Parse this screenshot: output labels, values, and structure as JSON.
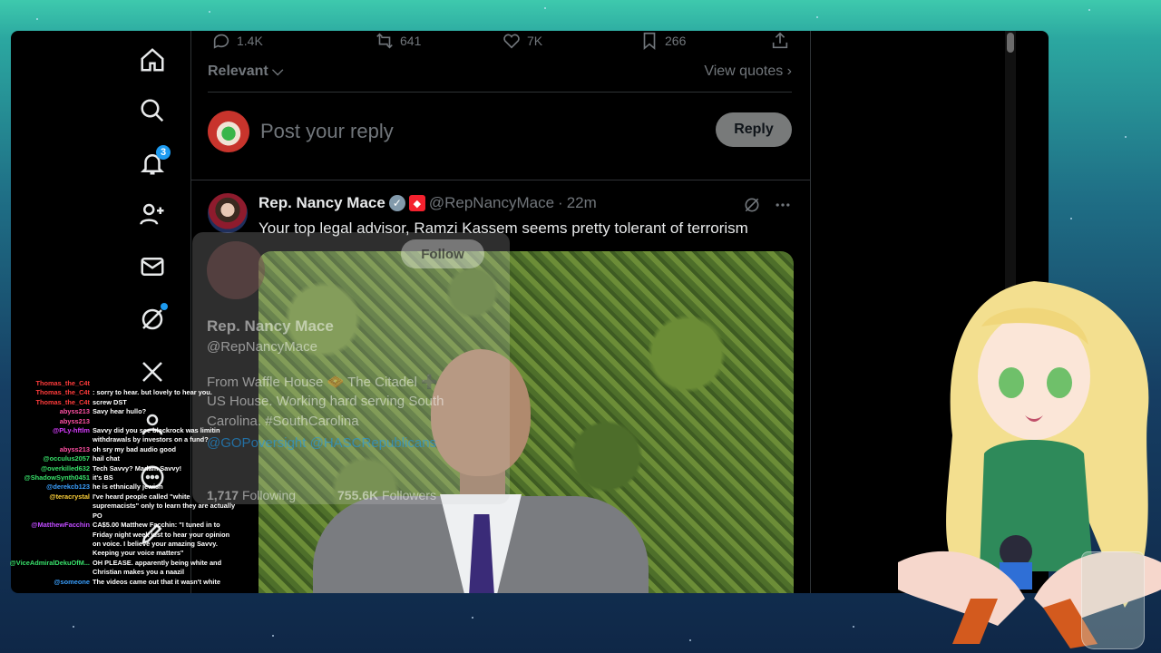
{
  "tweet_actions": {
    "replies": "1.4K",
    "reposts": "641",
    "likes": "7K",
    "bookmarks": "266"
  },
  "sort": {
    "label": "Relevant",
    "view_quotes": "View quotes"
  },
  "reply_box": {
    "placeholder": "Post your reply",
    "button": "Reply"
  },
  "nav": {
    "notifications_count": "3"
  },
  "tweet": {
    "author_name": "Rep. Nancy Mace",
    "handle": "@RepNancyMace",
    "time": "22m",
    "separator": "·",
    "text": "Your top legal advisor, Ramzi Kassem seems pretty tolerant of terrorism"
  },
  "hover_card": {
    "follow": "Follow",
    "name": "Rep. Nancy Mace",
    "handle": "@RepNancyMace",
    "bio_line1": "From Waffle House 🧇 The Citadel ➕",
    "bio_line2": "US House. Working hard serving South",
    "bio_line3": "Carolina. #SouthCarolina",
    "bio_line4": "@GOPoversight @HASCRepublicans",
    "following_count": "1,717",
    "following_label": "Following",
    "followers_count": "755.6K",
    "followers_label": "Followers"
  },
  "chat": [
    {
      "user": "Thomas_the_C4t",
      "color": "#ff3b3b",
      "msg": ""
    },
    {
      "user": "Thomas_the_C4t",
      "color": "#ff3b3b",
      "msg": ": sorry to hear. but lovely to hear you."
    },
    {
      "user": "Thomas_the_C4t",
      "color": "#ff3b3b",
      "msg": "screw DST"
    },
    {
      "user": "abyss213",
      "color": "#ff4fa3",
      "msg": "Savy hear hullo?"
    },
    {
      "user": "abyss213",
      "color": "#ff4fa3",
      "msg": ""
    },
    {
      "user": "@PLy-hftlm",
      "color": "#d73cff",
      "msg": "Savvy did you see blackrock was limitin withdrawals by investors on a fund?"
    },
    {
      "user": "abyss213",
      "color": "#ff4fa3",
      "msg": "oh sry my bad audio good"
    },
    {
      "user": "@occulus2057",
      "color": "#38e06a",
      "msg": "hail chat"
    },
    {
      "user": "@overkilled632",
      "color": "#38e06a",
      "msg": "Tech Savvy? Madam Savvy!"
    },
    {
      "user": "@ShadowSynth0451",
      "color": "#38e06a",
      "msg": "it's BS"
    },
    {
      "user": "@derekcb123",
      "color": "#3aa0ff",
      "msg": "he is ethnically jewish"
    },
    {
      "user": "@teracrystal",
      "color": "#ffd23a",
      "msg": "I've heard people called \"white supremacists\" only to learn they are actually PO"
    },
    {
      "user": "@MatthewFacchin",
      "color": "#c04bff",
      "msg": "CA$5.00 Matthew Facchin: \"I tuned in to Friday night week just to hear your opinion on voice. I believe your amazing Savvy. Keeping your voice matters\""
    },
    {
      "user": "@ViceAdmiralDekuOfM...",
      "color": "#38e06a",
      "msg": "OH PLEASE. apparently being white and Christian makes you a naazil"
    },
    {
      "user": "@someone",
      "color": "#3aa0ff",
      "msg": "The videos came out that it wasn't white"
    }
  ]
}
